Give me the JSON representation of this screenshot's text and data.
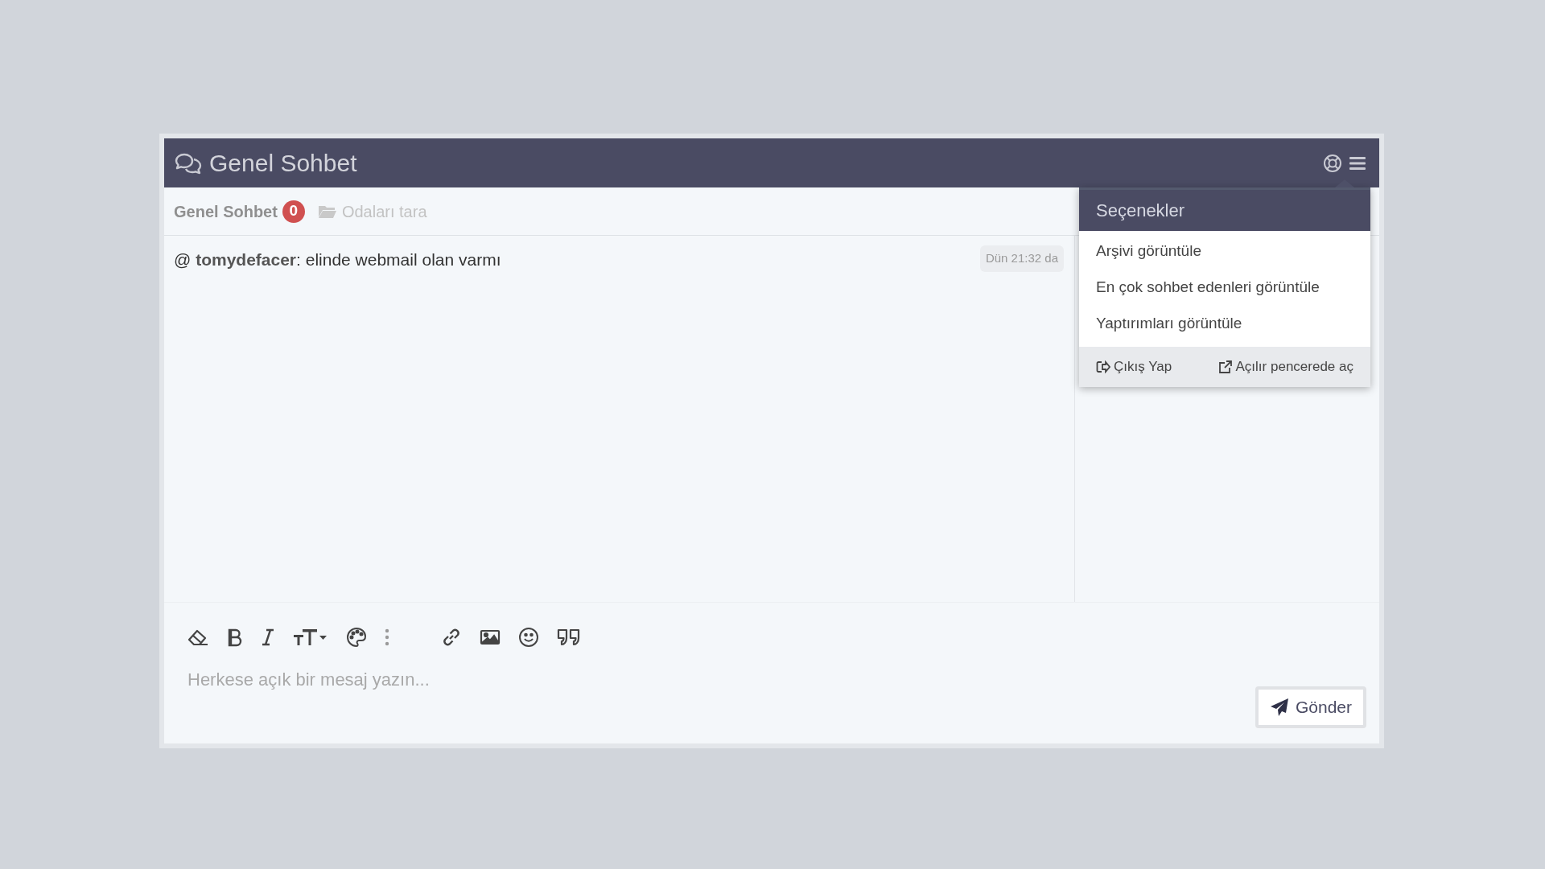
{
  "window": {
    "title": "Genel Sohbet"
  },
  "tabs": [
    {
      "kind": "room",
      "label": "Genel Sohbet",
      "badge": "0",
      "selected": true
    },
    {
      "kind": "browse",
      "label": "Odaları tara",
      "selected": false
    }
  ],
  "messages": [
    {
      "text": "@ **tomydefacer**: elinde webmail olan varmı",
      "time": "Dün 21:32 da"
    }
  ],
  "menu": {
    "title": "Seçenekler",
    "items": [
      "Arşivi görüntüle",
      "En çok sohbet edenleri görüntüle",
      "Yaptırımları görüntüle"
    ],
    "footer": [
      {
        "kind": "logout",
        "label": "Çıkış Yap"
      },
      {
        "kind": "popup",
        "label": "Açılır pencerede aç"
      }
    ]
  },
  "composer": {
    "placeholder": "Herkese açık bir mesaj yazın...",
    "send": "Gönder"
  }
}
